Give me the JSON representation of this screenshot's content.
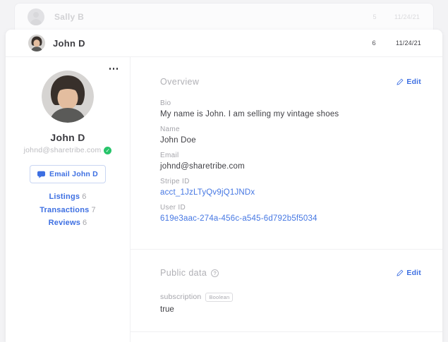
{
  "accent": "#3d6fe2",
  "prev_row": {
    "name": "Sally B",
    "count": "5",
    "date": "11/24/21"
  },
  "header_row": {
    "name": "John D",
    "count": "6",
    "date": "11/24/21"
  },
  "sidebar": {
    "name": "John D",
    "email": "johnd@sharetribe.com",
    "verified_icon": "✓",
    "email_button": "Email John D",
    "links": [
      {
        "label": "Listings",
        "count": "6"
      },
      {
        "label": "Transactions",
        "count": "7"
      },
      {
        "label": "Reviews",
        "count": "6"
      }
    ]
  },
  "overview": {
    "title": "Overview",
    "edit_label": "Edit",
    "fields": [
      {
        "label": "Bio",
        "value": "My name is John. I am selling my vintage shoes"
      },
      {
        "label": "Name",
        "value": "John Doe"
      },
      {
        "label": "Email",
        "value": "johnd@sharetribe.com"
      },
      {
        "label": "Stripe ID",
        "value": "acct_1JzLTyQv9jQ1JNDx"
      },
      {
        "label": "User ID",
        "value": "619e3aac-274a-456c-a545-6d792b5f5034"
      }
    ]
  },
  "public_data": {
    "title": "Public data",
    "help_icon": "?",
    "edit_label": "Edit",
    "entries": [
      {
        "key": "subscription",
        "type": "Boolean",
        "value": "true"
      }
    ]
  }
}
